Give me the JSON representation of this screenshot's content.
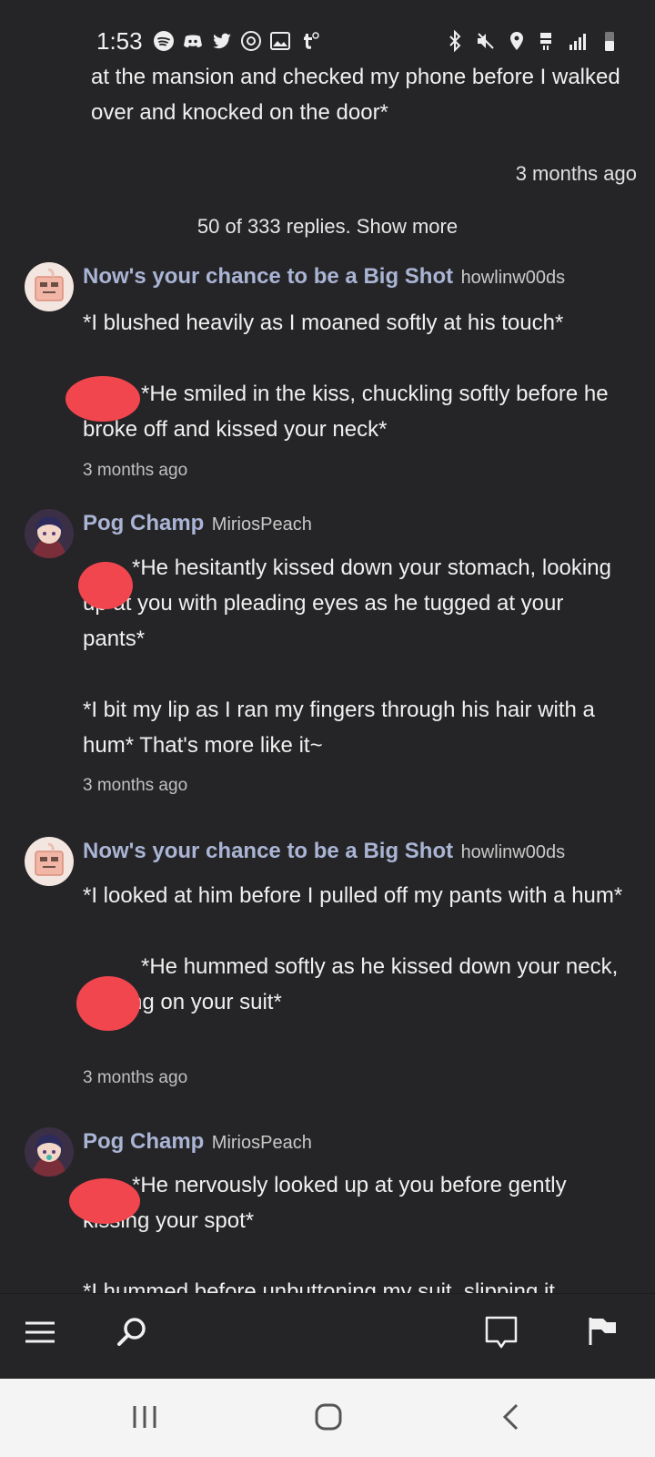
{
  "status_bar": {
    "time": "1:53",
    "left_icons": [
      "spotify-icon",
      "discord-icon",
      "twitter-icon",
      "threads-icon",
      "gallery-icon",
      "tumblr-icon"
    ],
    "right_icons": [
      "bluetooth-icon",
      "mute-icon",
      "location-icon",
      "lte-icon",
      "signal-icon",
      "battery-icon"
    ]
  },
  "thread": {
    "top_message": "at the mansion and checked my phone before I walked over and knocked on the door*",
    "top_timeago": "3 months ago",
    "replies_link": "50 of 333 replies. Show more"
  },
  "comments": [
    {
      "display_name": "Now's your chance to be a Big Shot",
      "username": "howlinw00ds",
      "paragraphs": [
        "*I blushed heavily as I moaned softly at his touch*",
        "*He smiled in the kiss, chuckling softly before he broke off and kissed your neck*"
      ],
      "timeago": "3 months ago"
    },
    {
      "display_name": "Pog Champ",
      "username": "MiriosPeach",
      "paragraphs": [
        "*He hesitantly kissed down your stomach, looking up at you with pleading eyes as he tugged at your pants*",
        "*I bit my lip as I ran my fingers through his hair with a hum* That's more like it~"
      ],
      "timeago": "3 months ago"
    },
    {
      "display_name": "Now's your chance to be a Big Shot",
      "username": "howlinw00ds",
      "paragraphs": [
        "*I looked at him before I pulled off my pants with a hum*",
        "*He hummed softly as he kissed down your neck, tugging on your suit*"
      ],
      "timeago": "3 months ago"
    },
    {
      "display_name": "Pog Champ",
      "username": "MiriosPeach",
      "paragraphs": [
        "*He nervously looked up at you before gently kissing your spot*",
        "*I hummed before unbuttoning my suit, slipping it"
      ]
    }
  ],
  "toolbar": {
    "icons": [
      "menu-icon",
      "search-icon",
      "comment-icon",
      "flag-icon"
    ]
  },
  "nav_bar": {
    "icons": [
      "recent-apps-icon",
      "home-icon",
      "back-icon"
    ]
  },
  "colors": {
    "background": "#252527",
    "display_name": "#aab4d4",
    "redaction": "#f2464f",
    "nav_bar": "#f4f4f4"
  }
}
